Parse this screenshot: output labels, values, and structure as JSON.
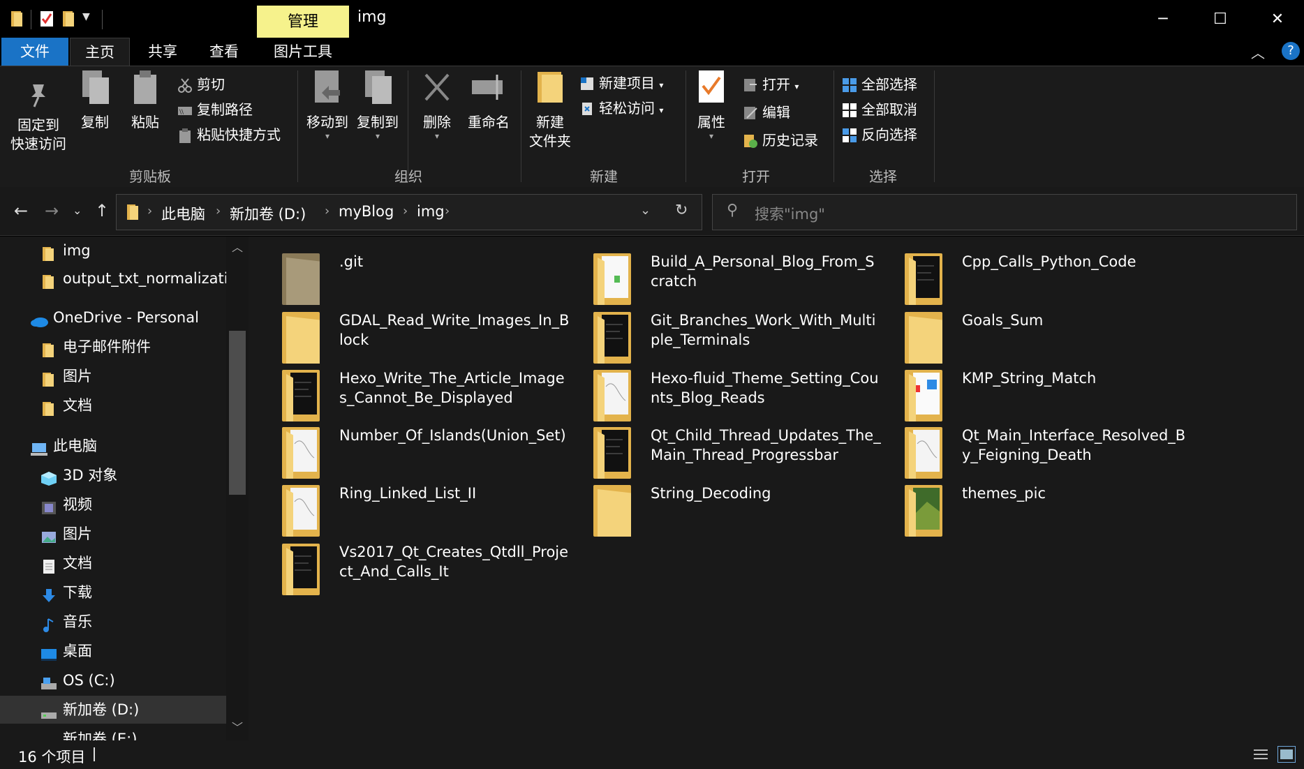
{
  "titlebar": {
    "manage_tab": "管理",
    "title": "img",
    "minimize": "─",
    "maximize": "☐",
    "close": "✕"
  },
  "tabs": {
    "file": "文件",
    "home": "主页",
    "share": "共享",
    "view": "查看",
    "picture_tools": "图片工具"
  },
  "ribbon": {
    "clipboard": {
      "pin": [
        "固定到",
        "快速访问"
      ],
      "copy": "复制",
      "paste": "粘贴",
      "cut": "剪切",
      "copy_path": "复制路径",
      "paste_shortcut": "粘贴快捷方式",
      "label": "剪贴板"
    },
    "organize": {
      "move_to": "移动到",
      "copy_to": "复制到",
      "delete": "删除",
      "rename": "重命名",
      "label": "组织"
    },
    "new": {
      "new_folder": [
        "新建",
        "文件夹"
      ],
      "new_item": "新建项目",
      "easy_access": "轻松访问",
      "label": "新建"
    },
    "open": {
      "properties": "属性",
      "open": "打开",
      "edit": "编辑",
      "history": "历史记录",
      "label": "打开"
    },
    "select": {
      "select_all": "全部选择",
      "select_none": "全部取消",
      "invert": "反向选择",
      "label": "选择"
    }
  },
  "address": {
    "crumbs": [
      "此电脑",
      "新加卷 (D:)",
      "myBlog",
      "img"
    ],
    "search_placeholder": "搜索\"img\""
  },
  "nav": {
    "items": [
      {
        "label": "img",
        "icon": "folder-icon"
      },
      {
        "label": "output_txt_normalization",
        "icon": "folder-icon"
      },
      {
        "label": "OneDrive - Personal",
        "icon": "onedrive-icon"
      },
      {
        "label": "电子邮件附件",
        "icon": "folder-icon"
      },
      {
        "label": "图片",
        "icon": "folder-icon"
      },
      {
        "label": "文档",
        "icon": "folder-icon"
      },
      {
        "label": "此电脑",
        "icon": "computer-icon"
      },
      {
        "label": "3D 对象",
        "icon": "3d-objects-icon"
      },
      {
        "label": "视频",
        "icon": "video-icon"
      },
      {
        "label": "图片",
        "icon": "pictures-icon"
      },
      {
        "label": "文档",
        "icon": "documents-icon"
      },
      {
        "label": "下载",
        "icon": "download-icon"
      },
      {
        "label": "音乐",
        "icon": "music-icon"
      },
      {
        "label": "桌面",
        "icon": "desktop-icon"
      },
      {
        "label": "OS (C:)",
        "icon": "drive-icon"
      },
      {
        "label": "新加卷 (D:)",
        "icon": "drive-icon"
      },
      {
        "label": "新加卷 (E:)",
        "icon": "drive-icon"
      }
    ]
  },
  "files": [
    {
      "name": ".git",
      "style": "gray"
    },
    {
      "name": "Build_A_Personal_Blog_From_Scratch",
      "style": "doc-green"
    },
    {
      "name": "Cpp_Calls_Python_Code",
      "style": "doc-dark"
    },
    {
      "name": "GDAL_Read_Write_Images_In_Block",
      "style": "plain"
    },
    {
      "name": "Git_Branches_Work_With_Multiple_Terminals",
      "style": "doc-dark"
    },
    {
      "name": "Goals_Sum",
      "style": "plain"
    },
    {
      "name": "Hexo_Write_The_Article_Images_Cannot_Be_Displayed",
      "style": "doc-dark"
    },
    {
      "name": "Hexo-fluid_Theme_Setting_Counts_Blog_Reads",
      "style": "doc-white"
    },
    {
      "name": "KMP_String_Match",
      "style": "doc-color"
    },
    {
      "name": "Number_Of_Islands(Union_Set)",
      "style": "doc-white"
    },
    {
      "name": "Qt_Child_Thread_Updates_The_Main_Thread_Progressbar",
      "style": "doc-dark"
    },
    {
      "name": "Qt_Main_Interface_Resolved_By_Feigning_Death",
      "style": "doc-white"
    },
    {
      "name": "Ring_Linked_List_II",
      "style": "doc-white"
    },
    {
      "name": "String_Decoding",
      "style": "plain"
    },
    {
      "name": "themes_pic",
      "style": "doc-green-dark"
    },
    {
      "name": "Vs2017_Qt_Creates_Qtdll_Project_And_Calls_It",
      "style": "doc-dark"
    }
  ],
  "status": {
    "count": "16 个项目"
  },
  "colors": {
    "accent": "#1a73c6",
    "manage_tab": "#f6f28c",
    "folder_back": "#e3b34c",
    "folder_front": "#f4d37b"
  }
}
